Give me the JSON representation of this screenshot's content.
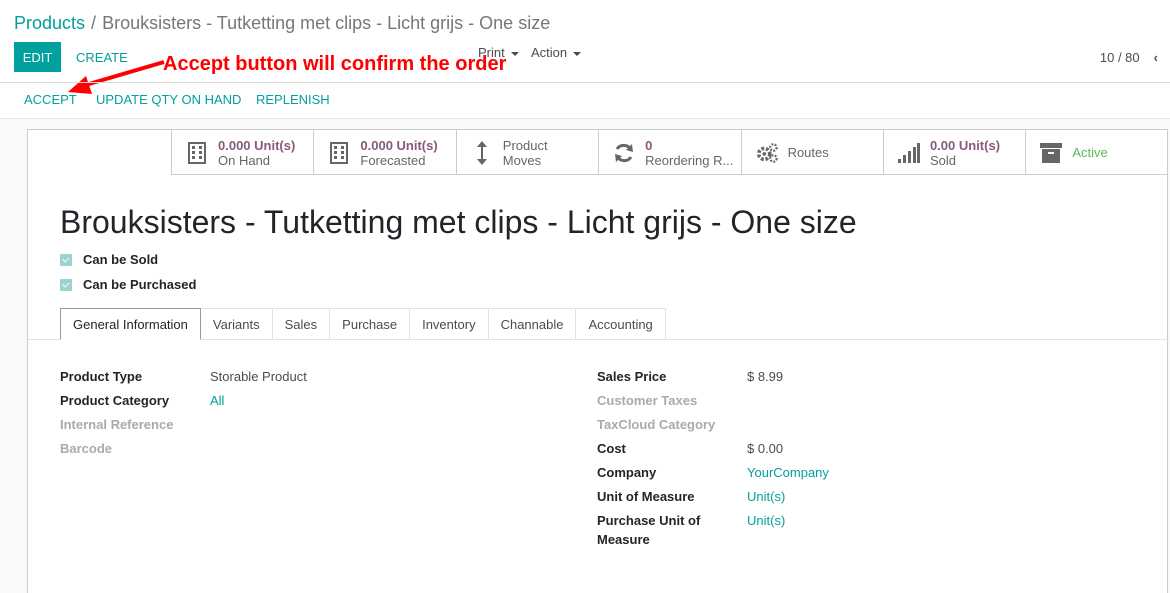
{
  "breadcrumb": {
    "parent": "Products",
    "separator": "/",
    "current": "Brouksisters - Tutketting met clips - Licht grijs - One size"
  },
  "buttons": {
    "edit": "EDIT",
    "create": "CREATE"
  },
  "dropdowns": {
    "print": "Print",
    "action": "Action"
  },
  "pager": {
    "value": "10 / 80"
  },
  "annotation": {
    "text": "Accept button will confirm the order",
    "color": "#ff0000"
  },
  "statusbar": {
    "accept": "ACCEPT",
    "update_qty": "UPDATE QTY ON HAND",
    "replenish": "REPLENISH"
  },
  "smart_buttons": [
    {
      "icon": "building-icon",
      "value": "0.000 Unit(s)",
      "label": "On Hand"
    },
    {
      "icon": "building-icon",
      "value": "0.000 Unit(s)",
      "label": "Forecasted"
    },
    {
      "icon": "arrows-vertical-icon",
      "value": "Product",
      "label": "Moves"
    },
    {
      "icon": "refresh-icon",
      "value": "0",
      "label": "Reordering R..."
    },
    {
      "icon": "cogs-icon",
      "value": "Routes",
      "label": ""
    },
    {
      "icon": "signal-icon",
      "value": "0.00 Unit(s)",
      "label": "Sold"
    },
    {
      "icon": "archive-icon",
      "value": "Active",
      "label": ""
    }
  ],
  "product": {
    "title": "Brouksisters - Tutketting met clips - Licht grijs - One size",
    "can_be_sold": "Can be Sold",
    "can_be_purchased": "Can be Purchased"
  },
  "tabs": [
    "General Information",
    "Variants",
    "Sales",
    "Purchase",
    "Inventory",
    "Channable",
    "Accounting"
  ],
  "left_fields": [
    {
      "label": "Product Type",
      "value": "Storable Product"
    },
    {
      "label": "Product Category",
      "value": "All"
    },
    {
      "label": "Internal Reference",
      "value": ""
    },
    {
      "label": "Barcode",
      "value": ""
    }
  ],
  "right_fields": [
    {
      "label": "Sales Price",
      "value": "$ 8.99"
    },
    {
      "label": "Customer Taxes",
      "value": ""
    },
    {
      "label": "TaxCloud Category",
      "value": ""
    },
    {
      "label": "Cost",
      "value": "$ 0.00"
    },
    {
      "label": "Company",
      "value": "YourCompany"
    },
    {
      "label": "Unit of Measure",
      "value": "Unit(s)"
    },
    {
      "label": "Purchase Unit of",
      "label2": "Measure",
      "value": "Unit(s)"
    }
  ],
  "colors": {
    "accent": "#00A09D",
    "stat_value": "#875A7B",
    "active": "#5cb85c"
  }
}
